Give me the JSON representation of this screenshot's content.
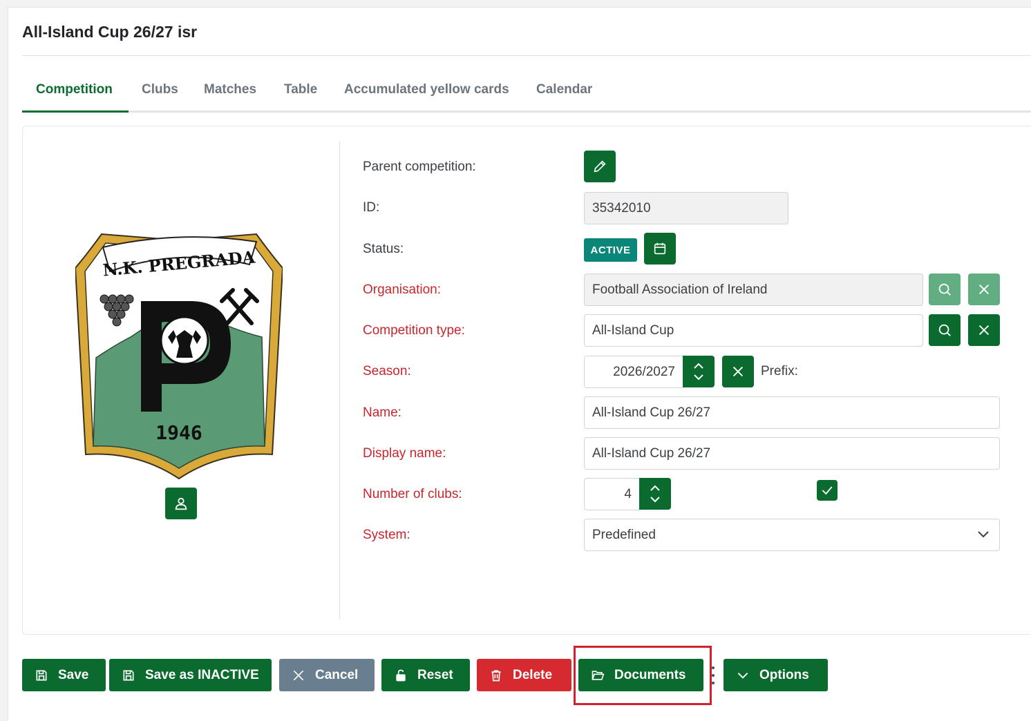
{
  "page": {
    "title": "All-Island Cup 26/27 isr"
  },
  "tabs": [
    {
      "label": "Competition",
      "active": true
    },
    {
      "label": "Clubs",
      "active": false
    },
    {
      "label": "Matches",
      "active": false
    },
    {
      "label": "Table",
      "active": false
    },
    {
      "label": "Accumulated yellow cards",
      "active": false
    },
    {
      "label": "Calendar",
      "active": false
    }
  ],
  "logo": {
    "banner_text": "N.K. PREGRADA",
    "year": "1946",
    "letter": "P"
  },
  "form": {
    "parent_competition": {
      "label": "Parent competition:"
    },
    "id": {
      "label": "ID:",
      "value": "35342010"
    },
    "status": {
      "label": "Status:",
      "badge": "ACTIVE"
    },
    "organisation": {
      "label": "Organisation:",
      "value": "Football Association of Ireland",
      "required": true
    },
    "competition_type": {
      "label": "Competition type:",
      "value": "All-Island Cup",
      "required": true
    },
    "season": {
      "label": "Season:",
      "value": "2026/2027",
      "prefix_label": "Prefix:",
      "prefix_checked": true,
      "required": true
    },
    "name": {
      "label": "Name:",
      "value": "All-Island Cup 26/27",
      "required": true
    },
    "display_name": {
      "label": "Display name:",
      "value": "All-Island Cup 26/27",
      "required": true
    },
    "number_of_clubs": {
      "label": "Number of clubs:",
      "value": "4",
      "required": true
    },
    "system": {
      "label": "System:",
      "value": "Predefined",
      "required": true
    }
  },
  "actions": {
    "save": "Save",
    "save_inactive": "Save as INACTIVE",
    "cancel": "Cancel",
    "reset": "Reset",
    "delete": "Delete",
    "documents": "Documents",
    "options": "Options"
  },
  "colors": {
    "primary": "#0b6b2e",
    "primary_light": "#62ad82",
    "required_label": "#c6262e",
    "badge_active": "#0b8779",
    "cancel": "#697f8f",
    "delete": "#d52b30",
    "highlight": "#d61f2c",
    "logo_green": "#5a9a74",
    "logo_gold": "#d9a93a"
  }
}
